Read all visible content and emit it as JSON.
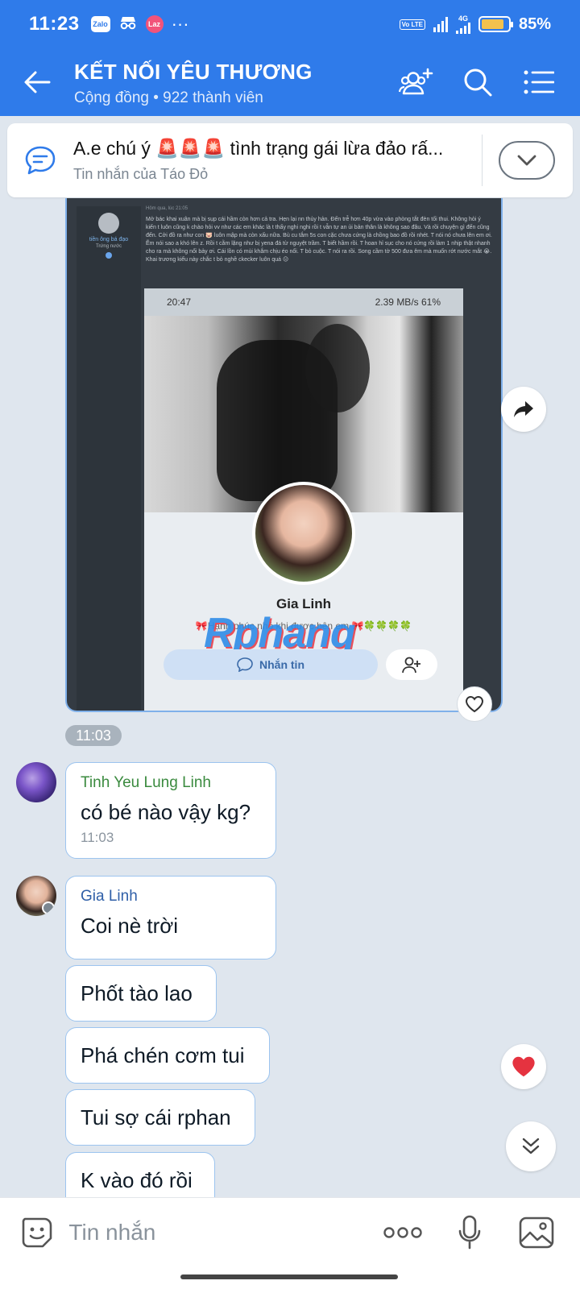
{
  "status_bar": {
    "time": "11:23",
    "app_icons": [
      "Zalo",
      "Laz"
    ],
    "more": "···",
    "network": "4G",
    "volte": "Vo LTE",
    "battery_percent": "85%",
    "battery_level": 0.85
  },
  "header": {
    "title": "KẾT NỐI YÊU THƯƠNG",
    "subtitle": "Cộng đồng • 922 thành viên"
  },
  "pinned": {
    "title": "A.e chú ý 🚨🚨🚨 tình trạng gái lừa đảo rấ...",
    "from": "Tin nhắn của Táo Đỏ"
  },
  "shared_image": {
    "sidebar_name": "tiền ông bá đạo",
    "sidebar_role": "Trứng nước",
    "post_meta": "Hôm qua, lúc 21:05",
    "post_text": "Mở bác khai xuân mà bị sụp cái hầm còn hơn cả tra. Hẹn lại nn thủy hản. Đến trễ hơn 40p vừa vào phòng tắt đèn tối thui. Không hỏi ý kiến t luôn cũng k chào hỏi vv như các em khác là t thấy nghi nghi rồi t vẫn tự an ủi bản thân là không sao đâu. Và rồi chuyện gì đến cũng đến. Cởi đồ ra như con 🐷 luôn mập mà còn xấu nữa. Bù cu tắm 5s con cặc chưa cứng là chồng bao đồ rồi nhét. T nói nó chưa lên em ơi. Ẽm nói sao a khó lên z. Rồi t cằm lặng như bị yena đá từ nguyệt trầm. T biết hầm rồi. T hoan hỉ sục cho nó cứng rồi làm 1 nhịp thật nhanh cho ra mà không nổi bảy ơi. Cái lồn có mùi khắm chịu éo nổi. T bỏ cuộc. T nói ra rồi. Song cầm tờ 500 đưa êm mà muốn rớt nước mắt 😭. Khai trương kiểu này chắc t bỏ nghề ckecker luôn quá 😑",
    "phone_time": "20:47",
    "phone_status": "2.39 MB/s  61%",
    "profile_name": "Gia Linh",
    "profile_motto": "🎀Hạnh phúc nhỏ khi được bên em 🎀🍀🍀🍀🍀",
    "watermark": "Rphang",
    "message_button": "Nhắn tin"
  },
  "image_time": "11:03",
  "messages": [
    {
      "sender": "Tinh Yeu Lung Linh",
      "text": "có bé nào vậy kg?",
      "time": "11:03"
    },
    {
      "sender": "Gia Linh",
      "text": "Coi nè trời"
    },
    {
      "text": "Phốt tào lao"
    },
    {
      "text": "Phá chén cơm tui"
    },
    {
      "text": "Tui sợ cái rphan"
    },
    {
      "text": "K vào đó rồi"
    }
  ],
  "input": {
    "placeholder": "Tin nhắn"
  },
  "colors": {
    "header_blue": "#2f7bea",
    "chat_bg": "#dfe6ee",
    "bubble_border": "#9cc4ef"
  }
}
